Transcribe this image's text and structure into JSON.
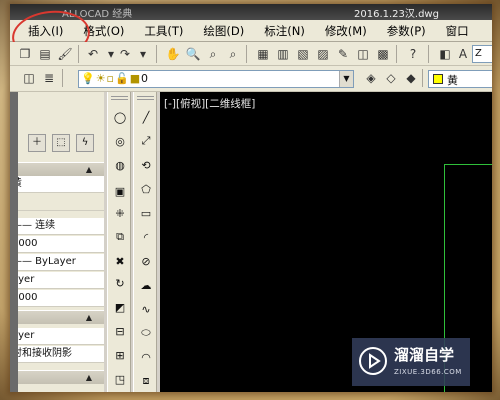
{
  "window": {
    "title_partial": "ALLOCAD 经典",
    "file_title": "2016.1.23汉.dwg"
  },
  "menu": {
    "items": [
      "插入(I)",
      "格式(O)",
      "工具(T)",
      "绘图(D)",
      "标注(N)",
      "修改(M)",
      "参数(P)",
      "窗口"
    ]
  },
  "toolbar": {
    "zoom_value": "Z"
  },
  "layers": {
    "current_layer": "0",
    "current_color": "黄",
    "highlight_color": "#d9382f"
  },
  "properties": {
    "rows": [
      "黄",
      "—— 连续",
      "0000",
      "—— ByLayer",
      "ayer",
      "0000",
      "ayer",
      "射和接收阴影"
    ]
  },
  "canvas": {
    "viewport_label": "[-][俯视][二维线框]"
  },
  "watermark": {
    "title": "溜溜自学",
    "url": "ZIXUE.3D66.COM"
  }
}
